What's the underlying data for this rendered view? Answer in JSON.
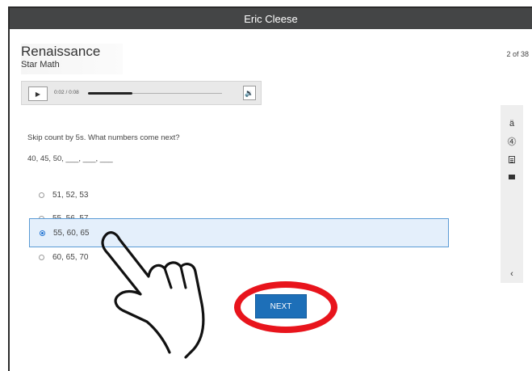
{
  "window": {
    "title": "Eric Cleese"
  },
  "brand": {
    "name": "Renaissance",
    "product": "Star Math"
  },
  "progress": {
    "counter": "2 of 38"
  },
  "audio": {
    "time": "0:02 / 0:08",
    "played_fraction": 0.33,
    "play_icon": "play-icon",
    "volume_icon": "speaker-icon"
  },
  "tools": {
    "items": [
      {
        "name": "translate-icon",
        "glyph": "ä"
      },
      {
        "name": "accessibility-icon",
        "glyph": "Ⓐ"
      },
      {
        "name": "calculator-icon",
        "glyph": ""
      },
      {
        "name": "line-reader-icon",
        "glyph": ""
      },
      {
        "name": "collapse-icon",
        "glyph": "<"
      }
    ]
  },
  "question": {
    "prompt": "Skip count by 5s. What numbers come next?",
    "sequence": "40, 45, 50, ___, ___, ___"
  },
  "options": [
    {
      "label": "51, 52, 53",
      "selected": false
    },
    {
      "label": "55, 56, 57",
      "selected": false
    },
    {
      "label": "55, 60, 65",
      "selected": true
    },
    {
      "label": "60, 65, 70",
      "selected": false
    }
  ],
  "next_button": {
    "label": "NEXT"
  },
  "colors": {
    "accent": "#1d6fb8",
    "highlight_ring": "#e8141c",
    "selected_bg": "#e4effb"
  }
}
